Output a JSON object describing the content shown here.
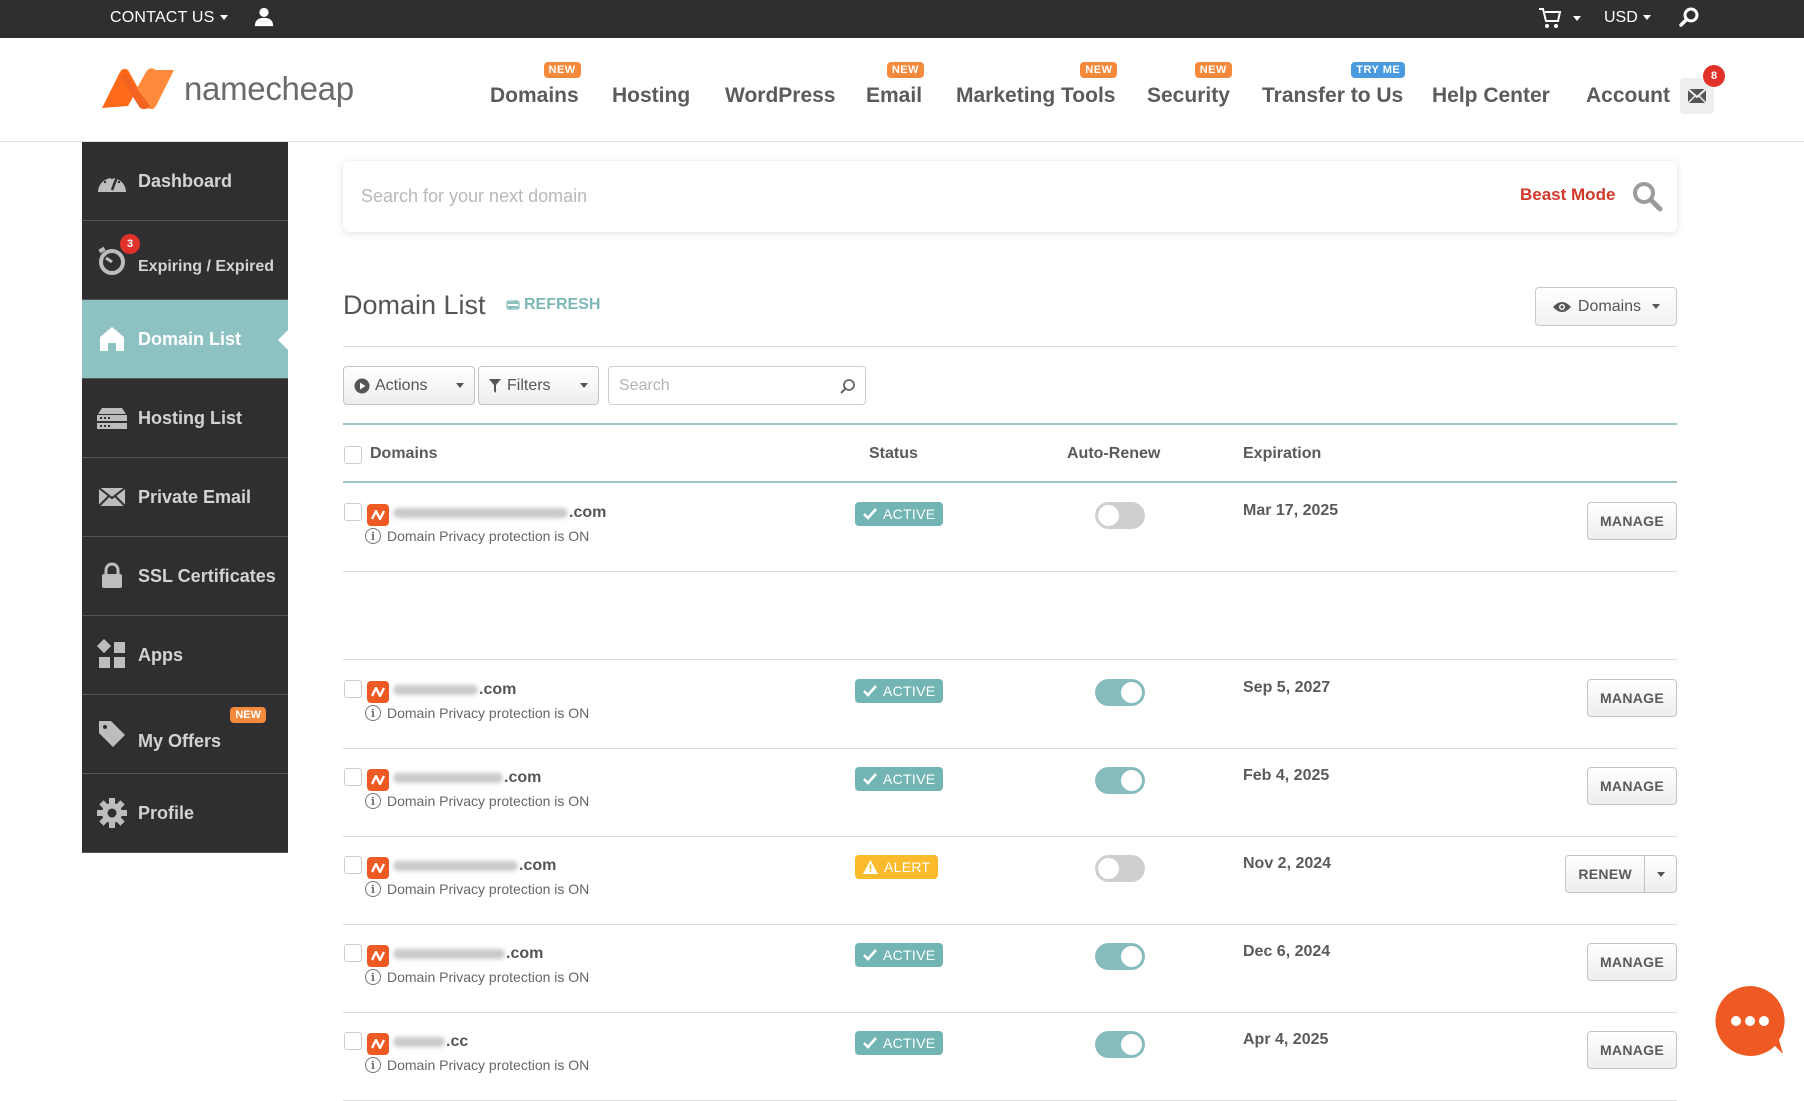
{
  "topbar": {
    "contact_label": "CONTACT US",
    "user_icon": "user-icon",
    "cart_icon": "cart-icon",
    "currency": "USD",
    "search_icon": "search-icon"
  },
  "header": {
    "logo_text": "namecheap",
    "nav": [
      {
        "label": "Domains",
        "badge": "NEW"
      },
      {
        "label": "Hosting",
        "badge": ""
      },
      {
        "label": "WordPress",
        "badge": ""
      },
      {
        "label": "Email",
        "badge": "NEW"
      },
      {
        "label": "Marketing Tools",
        "badge": "NEW"
      },
      {
        "label": "Security",
        "badge": "NEW"
      },
      {
        "label": "Transfer to Us",
        "badge": "TRY ME"
      },
      {
        "label": "Help Center",
        "badge": ""
      },
      {
        "label": "Account",
        "badge": ""
      }
    ],
    "mail_count": "8"
  },
  "sidebar": {
    "items": [
      {
        "label": "Dashboard",
        "icon": "speedometer-icon"
      },
      {
        "label": "Expiring / Expired",
        "icon": "stopwatch-icon",
        "count": "3"
      },
      {
        "label": "Domain List",
        "icon": "home-icon",
        "active": true
      },
      {
        "label": "Hosting List",
        "icon": "server-icon"
      },
      {
        "label": "Private Email",
        "icon": "envelope-icon"
      },
      {
        "label": "SSL Certificates",
        "icon": "lock-icon"
      },
      {
        "label": "Apps",
        "icon": "apps-icon"
      },
      {
        "label": "My Offers",
        "icon": "tag-icon",
        "badge": "NEW"
      },
      {
        "label": "Profile",
        "icon": "gear-icon"
      }
    ]
  },
  "domain_search": {
    "placeholder": "Search for your next domain",
    "beast_mode": "Beast Mode"
  },
  "main": {
    "title": "Domain List",
    "refresh": "REFRESH",
    "view_button": "Domains",
    "actions": "Actions",
    "filters": "Filters",
    "search_placeholder": "Search",
    "columns": {
      "domains": "Domains",
      "status": "Status",
      "auto_renew": "Auto-Renew",
      "expiration": "Expiration"
    },
    "rows": [
      {
        "domain_suffix": ".com",
        "privacy": "Domain Privacy protection is ON",
        "status": "ACTIVE",
        "auto_renew": false,
        "expiration": "Mar 17, 2025",
        "action": "MANAGE"
      },
      {
        "domain_suffix": ".com",
        "privacy": "Domain Privacy protection is ON",
        "status": "ACTIVE",
        "auto_renew": true,
        "expiration": "Sep 5, 2027",
        "action": "MANAGE"
      },
      {
        "domain_suffix": ".com",
        "privacy": "Domain Privacy protection is ON",
        "status": "ACTIVE",
        "auto_renew": true,
        "expiration": "Feb 4, 2025",
        "action": "MANAGE"
      },
      {
        "domain_suffix": ".com",
        "privacy": "Domain Privacy protection is ON",
        "status": "ALERT",
        "auto_renew": false,
        "expiration": "Nov 2, 2024",
        "action": "RENEW"
      },
      {
        "domain_suffix": ".com",
        "privacy": "Domain Privacy protection is ON",
        "status": "ACTIVE",
        "auto_renew": true,
        "expiration": "Dec 6, 2024",
        "action": "MANAGE"
      },
      {
        "domain_suffix": ".cc",
        "privacy": "Domain Privacy protection is ON",
        "status": "ACTIVE",
        "auto_renew": true,
        "expiration": "Apr 4, 2025",
        "action": "MANAGE"
      }
    ]
  },
  "colors": {
    "brand_orange": "#ef5a24",
    "accent_teal": "#8ec1c2",
    "active_badge": "#72b5b4",
    "alert_badge": "#fbbb2c",
    "beast_mode": "#d1392a"
  }
}
